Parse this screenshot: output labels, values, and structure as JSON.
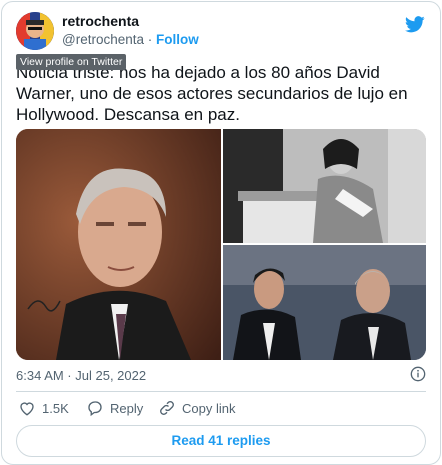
{
  "tweet": {
    "display_name": "retrochenta",
    "handle": "@retrochenta",
    "separator": "·",
    "follow_label": "Follow",
    "tooltip": "View profile on Twitter",
    "text": "Noticia triste: nos ha dejado a los 80 años David Warner, uno de esos actores secundarios de lujo en Hollywood. Descansa en paz.",
    "timestamp": "6:34 AM · Jul 25, 2022",
    "likes": "1.5K",
    "reply_label": "Reply",
    "copy_link_label": "Copy link",
    "read_replies_label": "Read 41 replies"
  },
  "colors": {
    "accent": "#1d9bf0",
    "muted": "#536471",
    "border": "#cfd9de"
  },
  "icons": [
    "twitter-bird-icon",
    "info-icon",
    "heart-icon",
    "reply-icon",
    "link-icon"
  ]
}
